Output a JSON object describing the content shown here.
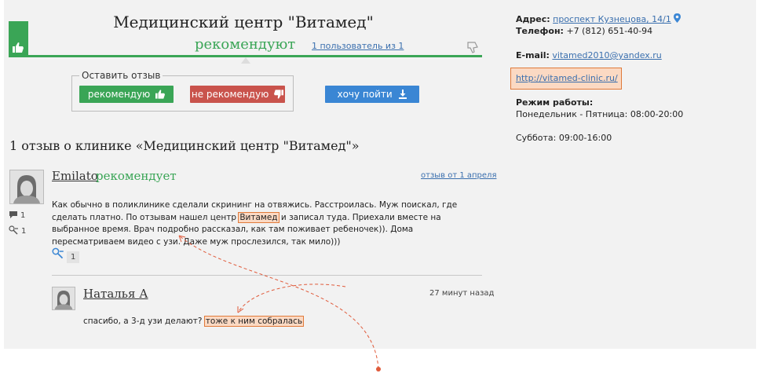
{
  "header": {
    "clinic_title": "Медицинский центр \"Витамед\"",
    "recommend_word": "рекомендуют",
    "users_link": "1 пользователь из 1"
  },
  "review_form": {
    "legend": "Оставить отзыв",
    "recommend_button": "рекомендую",
    "not_recommend_button": "не рекомендую",
    "want_to_go_button": "хочу пойти"
  },
  "section_heading": "1 отзыв о клинике «Медицинский центр \"Витамед\"»",
  "review": {
    "author": "Emilato",
    "verdict": "рекомендует",
    "date_link": "отзыв от 1 апреля",
    "text_part1": "Как обычно в поликлинике сделали скрининг на отвяжись. Расстроилась. Муж поискал, где сделать платно. По отзывам нашел центр ",
    "text_highlight": "Витамед",
    "text_part2": " и записал туда. Приехали вместе на выбранное время. Врач подробно рассказал, как там поживает ребеночек)). Дома пересматриваем видео с узи. Даже муж прослезился, так мило)))",
    "comments_count": "1",
    "helpful_count": "1",
    "helpful_button_count": "1"
  },
  "reply": {
    "author": "Наталья А",
    "time": "27 минут назад",
    "text_part1": "спасибо, а 3-д узи делают?",
    "text_highlight": "тоже к ним собралась"
  },
  "sidebar": {
    "address_label": "Адрес:",
    "address_value": "проспект Кузнецова, 14/1",
    "phone_label": "Телефон:",
    "phone_value": "+7 (812) 651-40-94",
    "email_label": "E-mail:",
    "email_value": "vitamed2010@yandex.ru",
    "website": "http://vitamed-clinic.ru/",
    "hours_label": "Режим работы:",
    "hours_weekdays": "Понедельник - Пятница: 08:00-20:00",
    "hours_saturday": "Суббота: 09:00-16:00"
  },
  "colors": {
    "accent_green": "#3aa556",
    "danger_red": "#c9534c",
    "primary_blue": "#3a86d4",
    "highlight": "#fbd9c3",
    "annotation": "#e05a3a"
  }
}
